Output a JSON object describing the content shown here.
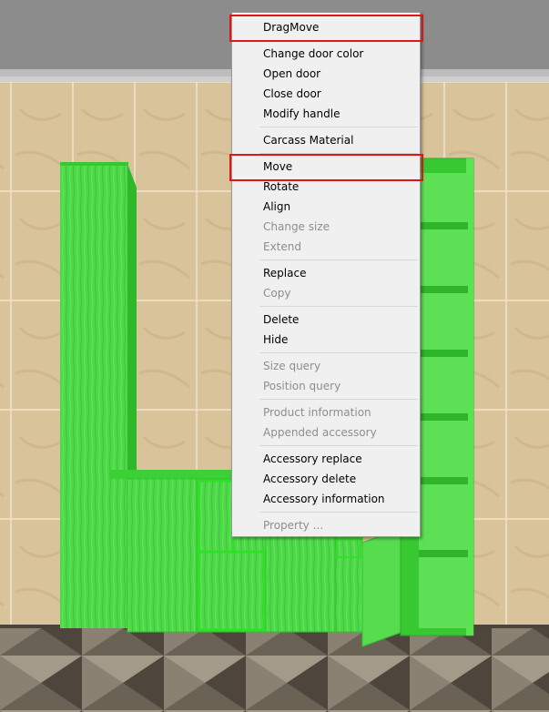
{
  "context_menu": {
    "items": [
      {
        "label": "DragMove",
        "enabled": true,
        "highlighted": true
      },
      {
        "separator": true
      },
      {
        "label": "Change door color",
        "enabled": true
      },
      {
        "label": "Open door",
        "enabled": true
      },
      {
        "label": "Close door",
        "enabled": true
      },
      {
        "label": "Modify handle",
        "enabled": true
      },
      {
        "separator": true
      },
      {
        "label": "Carcass Material",
        "enabled": true
      },
      {
        "separator": true
      },
      {
        "label": "Move",
        "enabled": true,
        "highlighted": true
      },
      {
        "label": "Rotate",
        "enabled": true
      },
      {
        "label": "Align",
        "enabled": true
      },
      {
        "label": "Change size",
        "enabled": false
      },
      {
        "label": "Extend",
        "enabled": false
      },
      {
        "separator": true
      },
      {
        "label": "Replace",
        "enabled": true
      },
      {
        "label": "Copy",
        "enabled": false
      },
      {
        "separator": true
      },
      {
        "label": "Delete",
        "enabled": true
      },
      {
        "label": "Hide",
        "enabled": true
      },
      {
        "separator": true
      },
      {
        "label": "Size query",
        "enabled": false
      },
      {
        "label": "Position query",
        "enabled": false
      },
      {
        "separator": true
      },
      {
        "label": "Product information",
        "enabled": false
      },
      {
        "label": "Appended accessory",
        "enabled": false
      },
      {
        "separator": true
      },
      {
        "label": "Accessory replace",
        "enabled": true
      },
      {
        "label": "Accessory delete",
        "enabled": true
      },
      {
        "label": "Accessory information",
        "enabled": true
      },
      {
        "separator": true
      },
      {
        "label": "Property ...",
        "enabled": false
      }
    ]
  },
  "colors": {
    "cabinet_green": "#4fd94a",
    "cabinet_edge": "#2fc92a",
    "wall_tile": "#d9c49c",
    "ceiling": "#8c8c8c",
    "floor": "#6e6558",
    "menu_bg": "#f0f0f0",
    "highlight_border": "#e01515"
  }
}
